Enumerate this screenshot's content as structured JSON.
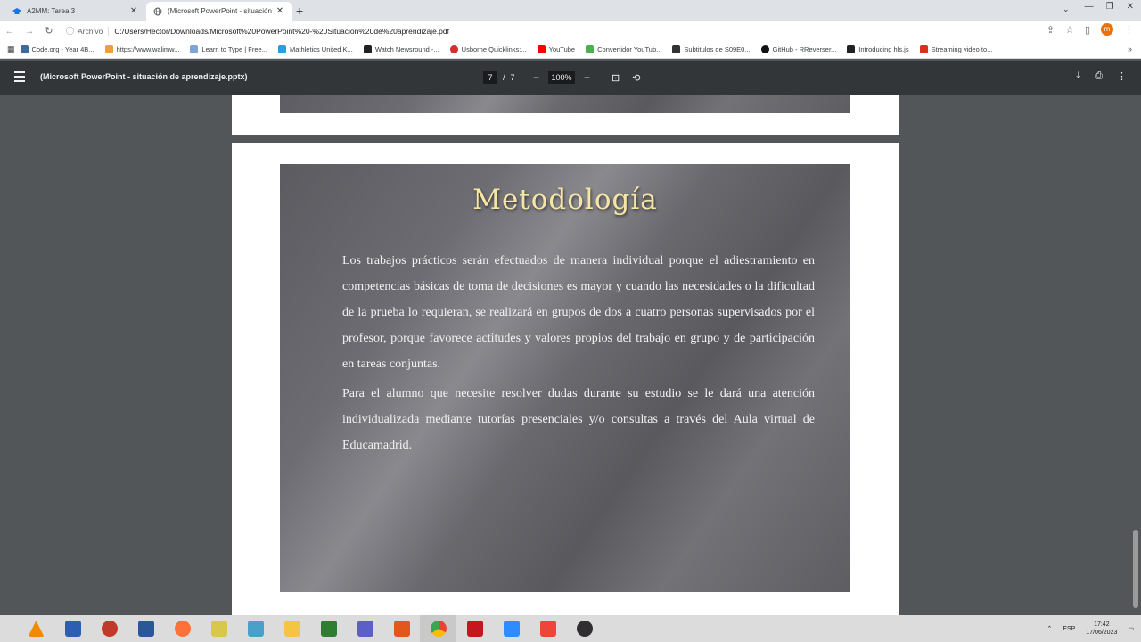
{
  "browser": {
    "tabs": [
      {
        "label": "A2MM: Tarea 3",
        "active": false,
        "icon": "graduation-cap-icon"
      },
      {
        "label": "(Microsoft PowerPoint - situación",
        "active": true,
        "icon": "globe-icon"
      }
    ],
    "new_tab_glyph": "+",
    "address": {
      "scheme": "Archivo",
      "url": "C:/Users/Hector/Downloads/Microsoft%20PowerPoint%20-%20Situación%20de%20aprendizaje.pdf"
    },
    "bookmarks": [
      {
        "label": "Code.org - Year 4B...",
        "color": "#3b6aa0"
      },
      {
        "label": "https://www.walimw...",
        "color": "#e8a23a"
      },
      {
        "label": "Learn to Type | Free...",
        "color": "#7fa5d6"
      },
      {
        "label": "Mathletics United K...",
        "color": "#29a0d8"
      },
      {
        "label": "Watch Newsround -...",
        "color": "#222222"
      },
      {
        "label": "Usborne Quicklinks:...",
        "color": "#d32f2f"
      },
      {
        "label": "YouTube",
        "color": "#ff0000"
      },
      {
        "label": "Convertidor YouTub...",
        "color": "#4caf50"
      },
      {
        "label": "Subtitulos de S09E0...",
        "color": "#333333"
      },
      {
        "label": "GitHub - RReverser...",
        "color": "#111111"
      },
      {
        "label": "Introducing hls.js",
        "color": "#222222"
      },
      {
        "label": "Streaming video to...",
        "color": "#d93025"
      }
    ],
    "bookmarks_more": "»",
    "profile_initial": "m"
  },
  "pdf": {
    "title": "(Microsoft PowerPoint - situación de aprendizaje.pptx)",
    "current_page": "7",
    "separator": "/",
    "total_pages": "7",
    "zoom_out": "−",
    "zoom": "100%",
    "zoom_in": "+"
  },
  "slide": {
    "title": "Metodología",
    "paragraphs": [
      "Los trabajos prácticos serán efectuados de manera individual porque el adiestramiento en competencias básicas de toma de decisiones es mayor y cuando las necesidades o la dificultad de la prueba lo requieran, se realizará en grupos de dos a cuatro personas supervisados por el profesor, porque favorece actitudes y valores propios del trabajo en grupo y de participación en tareas conjuntas.",
      "Para el alumno que necesite resolver dudas durante su estudio se le dará una atención individualizada mediante tutorías presenciales y/o consultas a través del Aula virtual de Educamadrid."
    ]
  },
  "taskbar": {
    "apps": [
      {
        "name": "vlc-icon",
        "color": "#f08a00"
      },
      {
        "name": "computer-icon",
        "color": "#2d5fb0"
      },
      {
        "name": "snipping-tool-icon",
        "color": "#c0392b"
      },
      {
        "name": "word-icon",
        "color": "#2b579a"
      },
      {
        "name": "firefox-icon",
        "color": "#ff7139"
      },
      {
        "name": "notes-icon",
        "color": "#d8c84a"
      },
      {
        "name": "notebook-icon",
        "color": "#4aa0c8"
      },
      {
        "name": "file-explorer-icon",
        "color": "#f4c542"
      },
      {
        "name": "spreadsheet-icon",
        "color": "#2e7d32"
      },
      {
        "name": "teams-icon",
        "color": "#5b5fc7"
      },
      {
        "name": "office-icon",
        "color": "#e2571e"
      },
      {
        "name": "chrome-icon",
        "color": "#4285f4"
      },
      {
        "name": "acrobat-icon",
        "color": "#c4161c"
      },
      {
        "name": "zoom-icon",
        "color": "#2d8cff"
      },
      {
        "name": "anydesk-icon",
        "color": "#ef443b"
      },
      {
        "name": "obs-icon",
        "color": "#302e31"
      }
    ],
    "active_index": 11,
    "language": "ESP",
    "time": "17:42",
    "date": "17/06/2023"
  }
}
